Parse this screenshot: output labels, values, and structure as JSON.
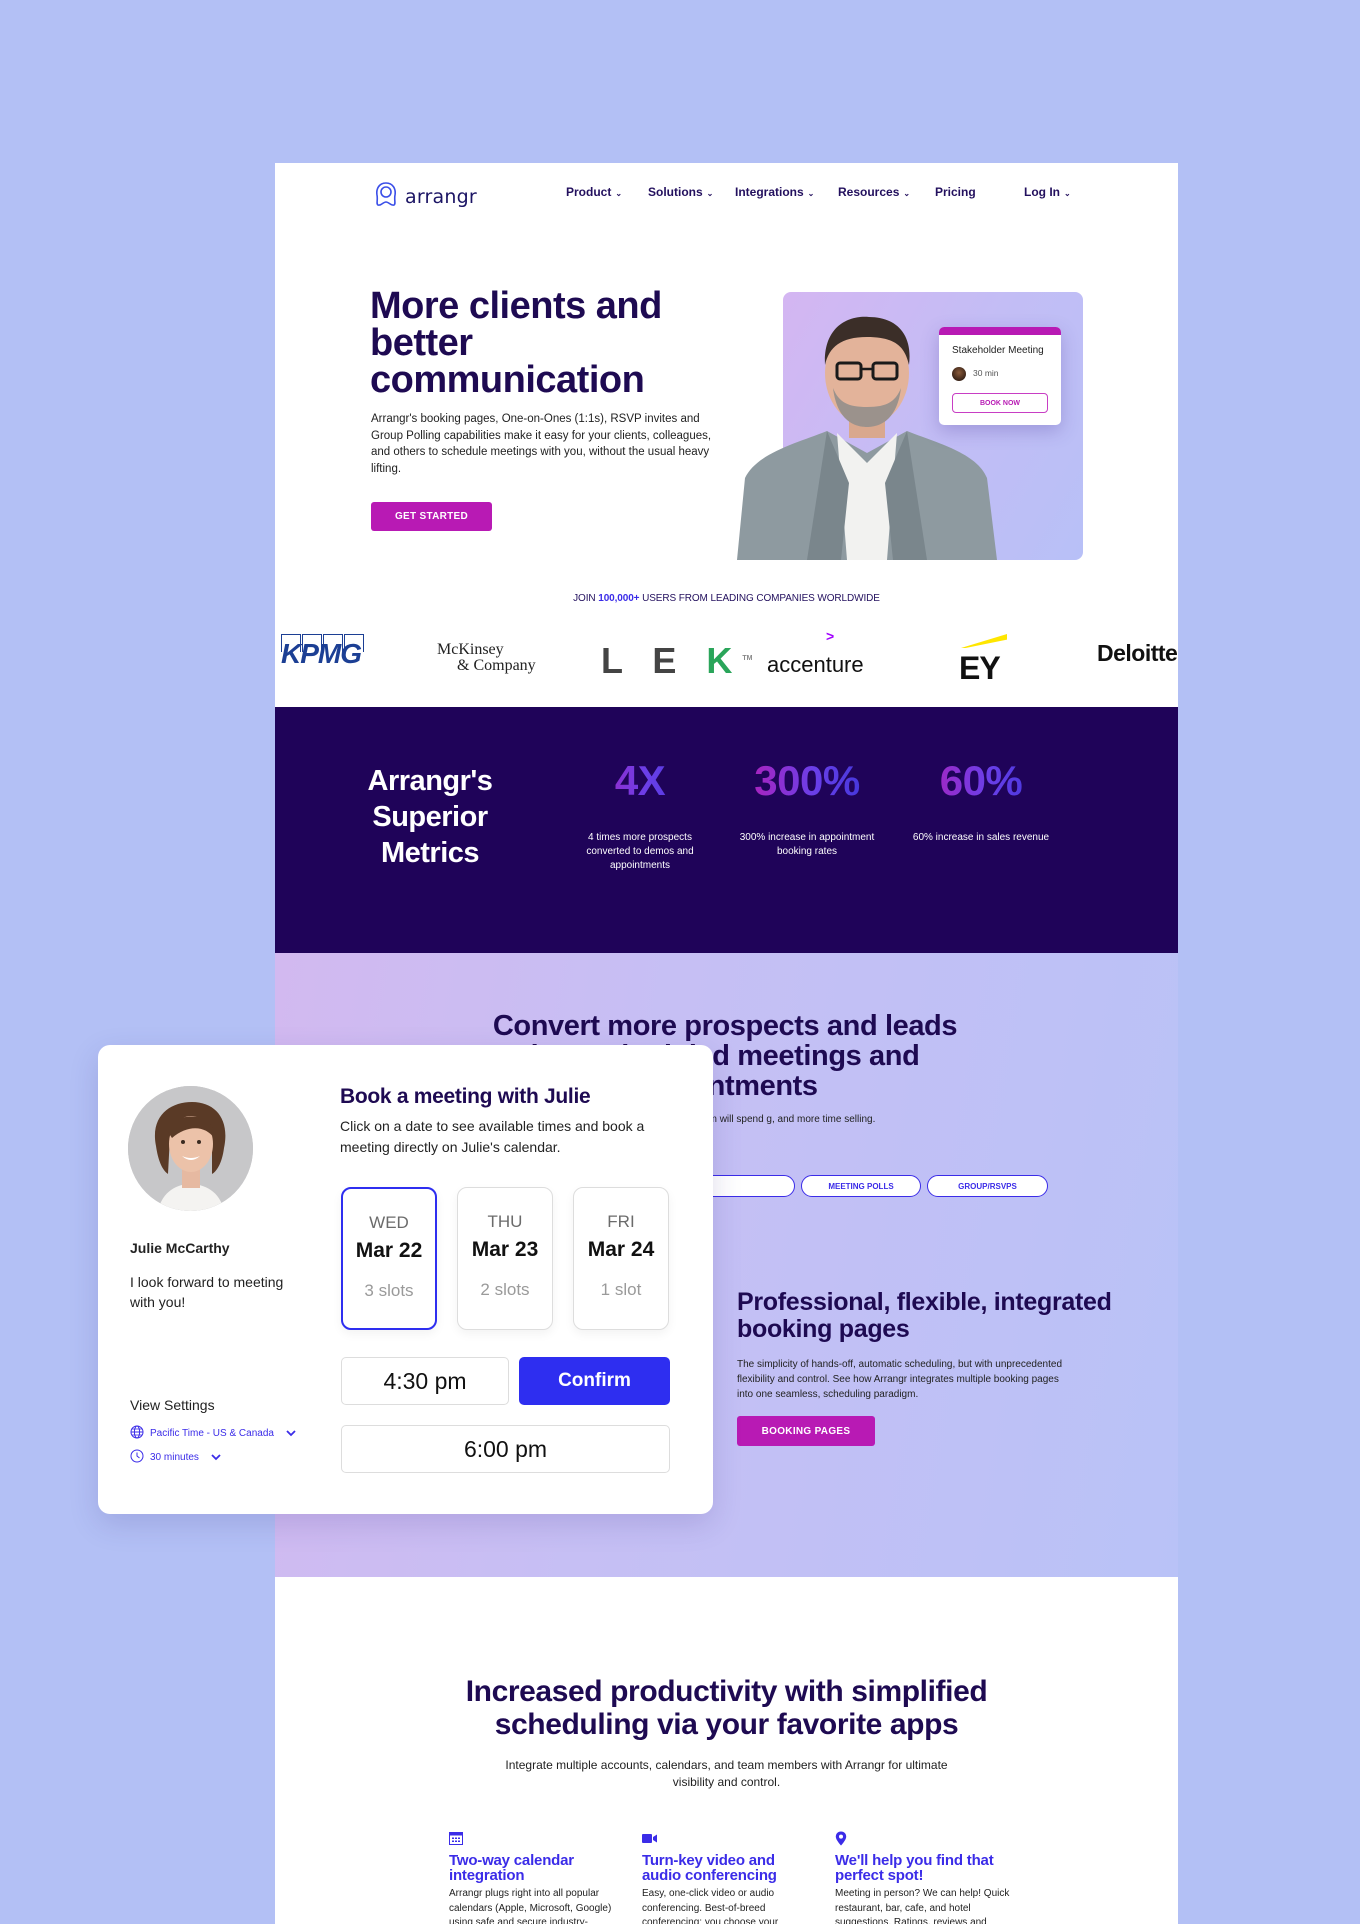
{
  "nav": {
    "logo_text": "arrangr",
    "items": [
      {
        "label": "Product",
        "has_dropdown": true
      },
      {
        "label": "Solutions",
        "has_dropdown": true
      },
      {
        "label": "Integrations",
        "has_dropdown": true
      },
      {
        "label": "Resources",
        "has_dropdown": true
      },
      {
        "label": "Pricing",
        "has_dropdown": false
      }
    ],
    "login_label": "Log In"
  },
  "hero": {
    "title": "More clients and better communication",
    "description": "Arrangr's booking pages, One-on-Ones (1:1s), RSVP invites and Group Polling capabilities make it easy for your clients, colleagues, and others to schedule meetings with you, without the usual heavy lifting.",
    "cta_label": "GET STARTED",
    "card": {
      "title": "Stakeholder Meeting",
      "duration": "30 min",
      "button_label": "BOOK NOW"
    }
  },
  "social_proof": {
    "prefix": "JOIN",
    "count": "100,000+",
    "suffix": "USERS FROM LEADING COMPANIES WORLDWIDE",
    "companies": [
      "KPMG",
      "McKinsey & Company",
      "LEK",
      "accenture",
      "EY",
      "Deloitte"
    ],
    "mckinsey_line1": "McKinsey",
    "mckinsey_line2": "& Company"
  },
  "metrics": {
    "title": "Arrangr's Superior Metrics",
    "items": [
      {
        "value": "4X",
        "description": "4 times more prospects converted to demos and appointments"
      },
      {
        "value": "300%",
        "description": "300% increase in appointment booking rates"
      },
      {
        "value": "60%",
        "description": "60% increase in sales revenue"
      }
    ]
  },
  "convert": {
    "title": "Convert more prospects and leads into scheduled meetings and appointments",
    "title_visible_lines": [
      "Convert more prospects and",
      "o scheduled",
      "l appointments"
    ],
    "description_visible": "oachable flows, your sales team will spend g, and more time selling.",
    "tags": [
      "",
      "MEETING POLLS",
      "GROUP/RSVPS"
    ]
  },
  "booking_pages": {
    "title": "Professional, flexible, integrated booking pages",
    "description": "The simplicity of hands-off, automatic scheduling, but with unprecedented flexibility and control. See how Arrangr integrates multiple booking pages into one seamless, scheduling paradigm.",
    "cta_label": "BOOKING PAGES"
  },
  "booking_widget": {
    "host_name": "Julie McCarthy",
    "host_message": "I look forward to meeting with you!",
    "title": "Book a meeting with Julie",
    "description": "Click on a date to see available times and book a meeting directly on Julie's calendar.",
    "days": [
      {
        "dow": "WED",
        "date": "Mar 22",
        "slots": "3 slots",
        "selected": true
      },
      {
        "dow": "THU",
        "date": "Mar 23",
        "slots": "2 slots",
        "selected": false
      },
      {
        "dow": "FRI",
        "date": "Mar 24",
        "slots": "1 slot",
        "selected": false
      }
    ],
    "times": [
      "4:30 pm",
      "6:00 pm"
    ],
    "confirm_label": "Confirm",
    "settings_label": "View Settings",
    "timezone": "Pacific Time - US & Canada",
    "duration": "30 minutes"
  },
  "productivity": {
    "title": "Increased productivity with simplified scheduling via your favorite apps",
    "description": "Integrate multiple accounts, calendars, and team members with Arrangr for ultimate visibility and control.",
    "features": [
      {
        "icon": "calendar-icon",
        "title": "Two-way calendar integration",
        "description": "Arrangr plugs right into all popular calendars (Apple, Microsoft, Google) using safe and secure industry-"
      },
      {
        "icon": "video-camera-icon",
        "title": "Turn-key video and audio conferencing",
        "description": "Easy, one-click video or audio conferencing. Best-of-breed conferencing; you choose your"
      },
      {
        "icon": "map-pin-icon",
        "title": "We'll help you find that perfect spot!",
        "description": "Meeting in person?  We can help! Quick restaurant, bar, cafe, and hotel suggestions. Ratings, reviews and"
      }
    ]
  },
  "colors": {
    "page_background": "#b3c0f5",
    "navy": "#1e0a52",
    "metrics_background": "#1f0359",
    "magenta": "#b81ab4",
    "blue": "#2e2ef0",
    "accent_blue": "#3b2ce8"
  }
}
